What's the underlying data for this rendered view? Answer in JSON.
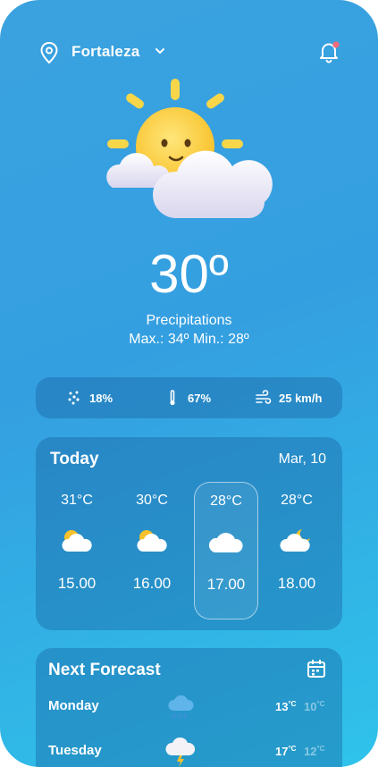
{
  "header": {
    "city": "Fortaleza"
  },
  "current": {
    "temperature": "30º",
    "condition": "Precipitations",
    "max_min": "Max.: 34º   Min.: 28º"
  },
  "stats": {
    "rain": "18%",
    "humidity": "67%",
    "wind": "25 km/h"
  },
  "today": {
    "title": "Today",
    "date": "Mar, 10",
    "hours": [
      {
        "temp": "31°C",
        "time": "15.00",
        "icon": "sun-cloud-icon"
      },
      {
        "temp": "30°C",
        "time": "16.00",
        "icon": "sun-cloud-icon"
      },
      {
        "temp": "28°C",
        "time": "17.00",
        "icon": "cloud-icon"
      },
      {
        "temp": "28°C",
        "time": "18.00",
        "icon": "moon-cloud-icon"
      }
    ]
  },
  "next_forecast": {
    "title": "Next Forecast",
    "days": [
      {
        "name": "Monday",
        "hi": "13",
        "lo": "10",
        "unit": "°C",
        "icon": "rain-cloud-icon"
      },
      {
        "name": "Tuesday",
        "hi": "17",
        "lo": "12",
        "unit": "°C",
        "icon": "storm-cloud-icon"
      }
    ]
  },
  "colors": {
    "bg_top": "#3aa2df",
    "bg_bottom": "#2fc3ea",
    "alert_dot": "#f06b7a"
  }
}
